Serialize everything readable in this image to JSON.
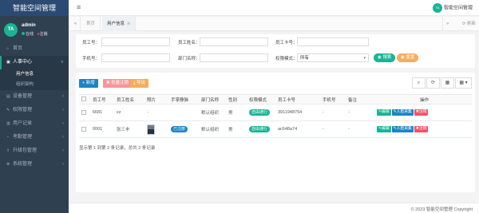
{
  "app": {
    "title": "智能空间管理"
  },
  "profile": {
    "avatar_text": "TA",
    "name": "admin",
    "status": "在线",
    "logout": "注销"
  },
  "sidebar": {
    "items": [
      {
        "icon": "home-icon",
        "glyph": "⌂",
        "label": "首页"
      },
      {
        "icon": "id-card-icon",
        "glyph": "▣",
        "label": "人事中心",
        "active": true,
        "chevron": "∨"
      },
      {
        "icon": "device-icon",
        "glyph": "▤",
        "label": "设备管理",
        "chevron": "‹"
      },
      {
        "icon": "rights-icon",
        "glyph": "✎",
        "label": "权限管理",
        "chevron": "‹"
      },
      {
        "icon": "record-icon",
        "glyph": "▥",
        "label": "用户记录",
        "chevron": "‹"
      },
      {
        "icon": "attendance-icon",
        "glyph": "◔",
        "label": "考勤管理",
        "chevron": "‹"
      },
      {
        "icon": "upgrade-icon",
        "glyph": "⇪",
        "label": "升级包管理",
        "chevron": "‹"
      },
      {
        "icon": "system-icon",
        "glyph": "⚙",
        "label": "系统管理",
        "chevron": "‹"
      }
    ],
    "sub_items": [
      {
        "label": "用户信息",
        "current": true
      },
      {
        "label": "组织架构"
      }
    ]
  },
  "topbar": {
    "menu_glyph": "≡",
    "user_avatar": "TA",
    "user_label": "智能空间管理"
  },
  "tabs": {
    "back": "«",
    "home": "首页",
    "active": "用户信息",
    "close": "⊗",
    "forward": "»",
    "refresh": "⟳ 刷新"
  },
  "search": {
    "emp_no_label": "员工号：",
    "emp_name_label": "员工姓名：",
    "card_no_label": "员工卡号：",
    "phone_label": "手机号：",
    "dept_label": "部门名称：",
    "perm_label": "权限模式：",
    "perm_value": "所有",
    "search_btn": "◉ 搜索",
    "reset_btn": "◉ 重置"
  },
  "toolbar": {
    "add": "+ 新增",
    "batch_cancel": "✖ 批量注销",
    "export": "⤓ 导出",
    "search_icon": "⌕",
    "refresh_icon": "⟳",
    "columns_icon": "▦",
    "grid_icon": "▦ ▾"
  },
  "table": {
    "headers": [
      "员工号",
      "员工姓名",
      "照片",
      "手掌静脉",
      "部门名称",
      "性别",
      "权限模式",
      "员工卡号",
      "手机号",
      "备注",
      "操作"
    ],
    "rows": [
      {
        "emp_no": "6681",
        "name": "xz",
        "photo": "-",
        "vein": "",
        "dept": "默认组织",
        "gender": "男",
        "perm": "自由通行",
        "card": "3911948754",
        "phone": "-",
        "note": "-"
      },
      {
        "emp_no": "0001",
        "name": "张三丰",
        "photo": "",
        "vein": "已注册",
        "dept": "默认组织",
        "gender": "男",
        "perm": "自由通行",
        "card": "ac648a74",
        "phone": "-",
        "note": "-"
      }
    ],
    "ops": {
      "edit": "✎编辑",
      "face": "✎人脸采集",
      "cancel": "✖注销"
    }
  },
  "pager": {
    "summary": "显示第 1 到第 2 条记录，总共 2 条记录"
  },
  "footer": {
    "copyright": "© 2023 智能空间管理 Copyright"
  }
}
